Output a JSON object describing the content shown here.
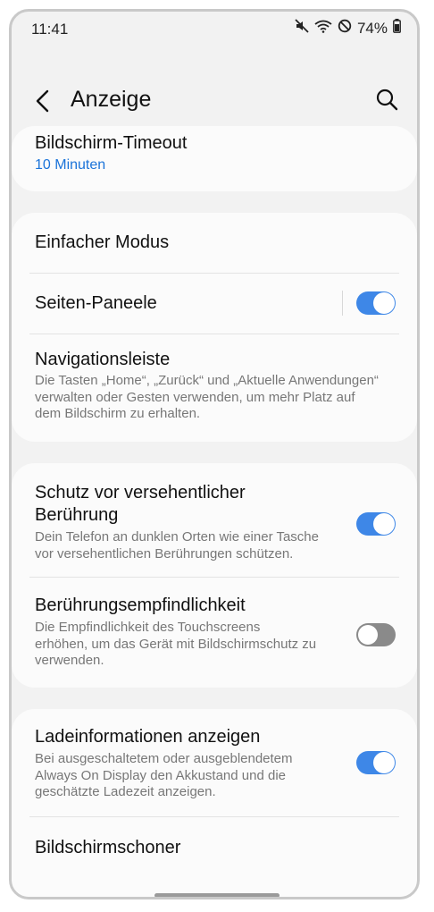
{
  "status": {
    "time": "11:41",
    "battery": "74%",
    "icons": [
      "mute-icon",
      "wifi-icon",
      "no-disturb-icon",
      "battery-icon"
    ]
  },
  "header": {
    "title": "Anzeige",
    "back_icon": "chevron-left-icon",
    "search_icon": "search-icon"
  },
  "colors": {
    "accent": "#3e87e7",
    "link": "#1a73d9",
    "background": "#f2f2f2",
    "card": "#fbfbfb"
  },
  "items": [
    {
      "title": "Bildschirm-Timeout",
      "subtitle": "10 Minuten"
    },
    {
      "title": "Einfacher Modus"
    },
    {
      "title": "Seiten-Paneele",
      "toggle": true
    },
    {
      "title": "Navigationsleiste",
      "desc_lines": [
        "Die Tasten „Home“, „Zurück“ und „Aktuelle Anwendungen“",
        "verwalten oder Gesten verwenden, um mehr Platz auf",
        "dem Bildschirm zu erhalten."
      ]
    },
    {
      "title_lines": [
        "Schutz vor versehentlicher",
        "Berührung"
      ],
      "desc_lines": [
        "Dein Telefon an dunklen Orten wie einer Tasche",
        "vor versehentlichen Berührungen schützen."
      ],
      "toggle": true
    },
    {
      "title": "Berührungsempfindlichkeit",
      "desc_lines": [
        "Die Empfindlichkeit des Touchscreens",
        "erhöhen, um das Gerät mit Bildschirmschutz zu",
        "verwenden."
      ],
      "toggle": false
    },
    {
      "title": "Ladeinformationen anzeigen",
      "desc_lines": [
        "Bei ausgeschaltetem oder ausgeblendetem",
        "Always On Display den Akkustand und die",
        "geschätzte Ladezeit anzeigen."
      ],
      "toggle": true
    },
    {
      "title": "Bildschirmschoner"
    }
  ]
}
